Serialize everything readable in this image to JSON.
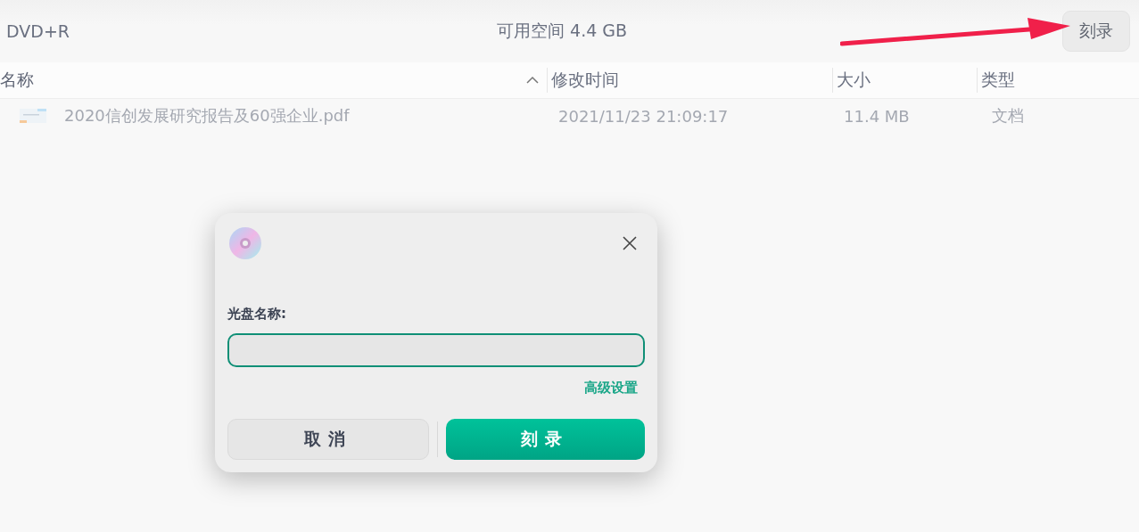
{
  "toolbar": {
    "disc_type": "DVD+R",
    "free_space": "可用空间 4.4 GB",
    "burn_button": "刻录"
  },
  "table": {
    "columns": [
      {
        "label": "名称",
        "sorted": true
      },
      {
        "label": "修改时间",
        "sorted": false
      },
      {
        "label": "大小",
        "sorted": false
      },
      {
        "label": "类型",
        "sorted": false
      }
    ],
    "rows": [
      {
        "name": "2020信创发展研究报告及60强企业.pdf",
        "modified": "2021/11/23 21:09:17",
        "size": "11.4 MB",
        "type": "文档"
      }
    ]
  },
  "dialog": {
    "label": "光盘名称:",
    "input": {
      "focused": true
    },
    "advanced_link": "高级设置",
    "buttons": [
      {
        "label": "取消",
        "kind": "secondary"
      },
      {
        "label": "刻录",
        "kind": "primary"
      }
    ]
  },
  "annotation": {
    "kind": "arrow"
  }
}
